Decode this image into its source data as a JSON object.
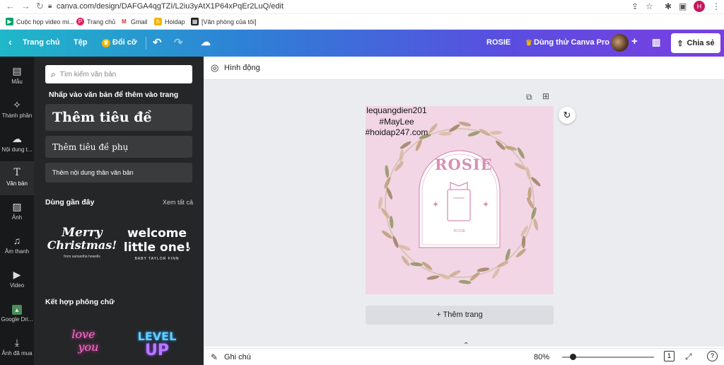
{
  "browser": {
    "url": "canva.com/design/DAFGA4qgTZI/L2iu3yAtX1P64xPqEr2LuQ/edit",
    "profile_initial": "H",
    "bookmarks": [
      "Cuộc họp video mi...",
      "Trang chủ",
      "Gmail",
      "Hoidap",
      "[Văn phòng của tôi]"
    ]
  },
  "header": {
    "home": "Trang chủ",
    "file": "Tệp",
    "resize": "Đổi cỡ",
    "design_title": "ROSIE",
    "try_pro": "Dùng thử Canva Pro",
    "share": "Chia sẻ"
  },
  "rail": [
    {
      "label": "Mẫu",
      "icon": "template-icon"
    },
    {
      "label": "Thành phần",
      "icon": "elements-icon"
    },
    {
      "label": "Nội dung t...",
      "icon": "upload-icon"
    },
    {
      "label": "Văn bản",
      "icon": "text-icon"
    },
    {
      "label": "Ảnh",
      "icon": "photo-icon"
    },
    {
      "label": "Âm thanh",
      "icon": "music-icon"
    },
    {
      "label": "Video",
      "icon": "video-icon"
    },
    {
      "label": "Google Dri...",
      "icon": "google-drive-icon"
    },
    {
      "label": "Ảnh đã mua",
      "icon": "download-icon"
    }
  ],
  "panel": {
    "search_placeholder": "Tìm kiếm văn bản",
    "hint": "Nhấp vào văn bản để thêm vào trang",
    "heading": "Thêm tiêu đề",
    "subheading": "Thêm tiêu đề phụ",
    "body": "Thêm nội dung thân văn bản",
    "recent_title": "Dùng gần đây",
    "see_all": "Xem tất cả",
    "recent": [
      {
        "line1": "Merry",
        "line2": "Christmas!",
        "caption": "from samantha howells"
      },
      {
        "line1": "welcome",
        "line2": "little one!",
        "caption": "BABY TAYLOR FINN"
      }
    ],
    "combos_title": "Kết hợp phông chữ",
    "combos": [
      {
        "line1": "love",
        "line2": "you"
      },
      {
        "line1": "LEVEL",
        "line2": "UP"
      }
    ]
  },
  "editor": {
    "animate": "Hình động",
    "page_text": [
      "lequangdien201",
      "#MayLee",
      "#hoidap247.com"
    ],
    "logo_title": "ROSIE",
    "logo_caption": "ROSIE",
    "add_page": "+ Thêm trang",
    "notes": "Ghi chú",
    "zoom": "80%",
    "page_count": "1"
  },
  "colors": {
    "page_bg": "#f2d6e6",
    "logo_pink": "#d88fb4",
    "panel_bg": "#252627",
    "rail_bg": "#18191b"
  }
}
